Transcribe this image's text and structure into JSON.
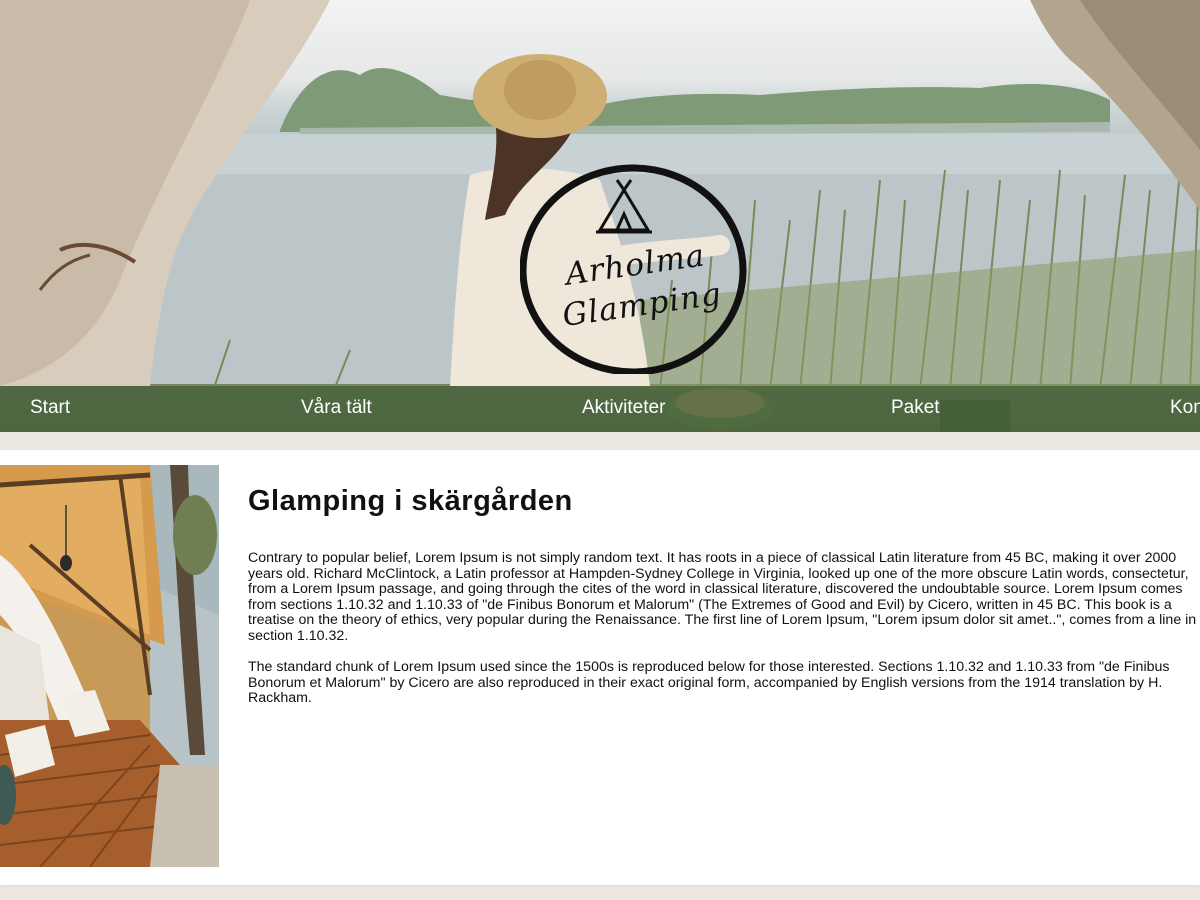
{
  "logo": {
    "line1": "Arholma",
    "line2": "Glamping"
  },
  "nav": {
    "items": [
      "Start",
      "Våra tält",
      "Aktiviteter",
      "Paket",
      "Kontakt"
    ]
  },
  "article": {
    "title": "Glamping i skärgården",
    "paragraph1_lines": [
      "Contrary to popular belief, Lorem Ipsum is not simply random text. It has roots in a piece of classical Latin literature from 45 BC, making it over 2000",
      "years old. Richard McClintock, a Latin professor at Hampden-Sydney College in Virginia, looked up one of the more obscure Latin words, consectetur,",
      "from a Lorem Ipsum passage, and going through the cites of the word in classical literature, discovered the undoubtable source. Lorem Ipsum comes",
      "from sections 1.10.32 and 1.10.33 of \"de Finibus Bonorum et Malorum\" (The Extremes of Good and Evil) by Cicero, written in 45 BC. This book is a",
      "treatise on the theory of ethics, very popular during the Renaissance. The first line of Lorem Ipsum, \"Lorem ipsum dolor sit amet..\", comes from a line in",
      "section 1.10.32."
    ],
    "paragraph2_lines": [
      "The standard chunk of Lorem Ipsum used since the 1500s is reproduced below for those interested. Sections 1.10.32 and 1.10.33 from \"de Finibus",
      "Bonorum et Malorum\" by Cicero are also reproduced in their exact original form, accompanied by English versions from the 1914 translation by H.",
      "Rackham."
    ]
  },
  "colors": {
    "nav_bg": "#46623a",
    "nav_text": "#ffffff",
    "page_bg": "#ece7df",
    "card_bg": "#ffffff",
    "text": "#111111"
  },
  "icons": {
    "logo": "tipi-tent-icon",
    "photo": "glamping-tent-photo"
  }
}
